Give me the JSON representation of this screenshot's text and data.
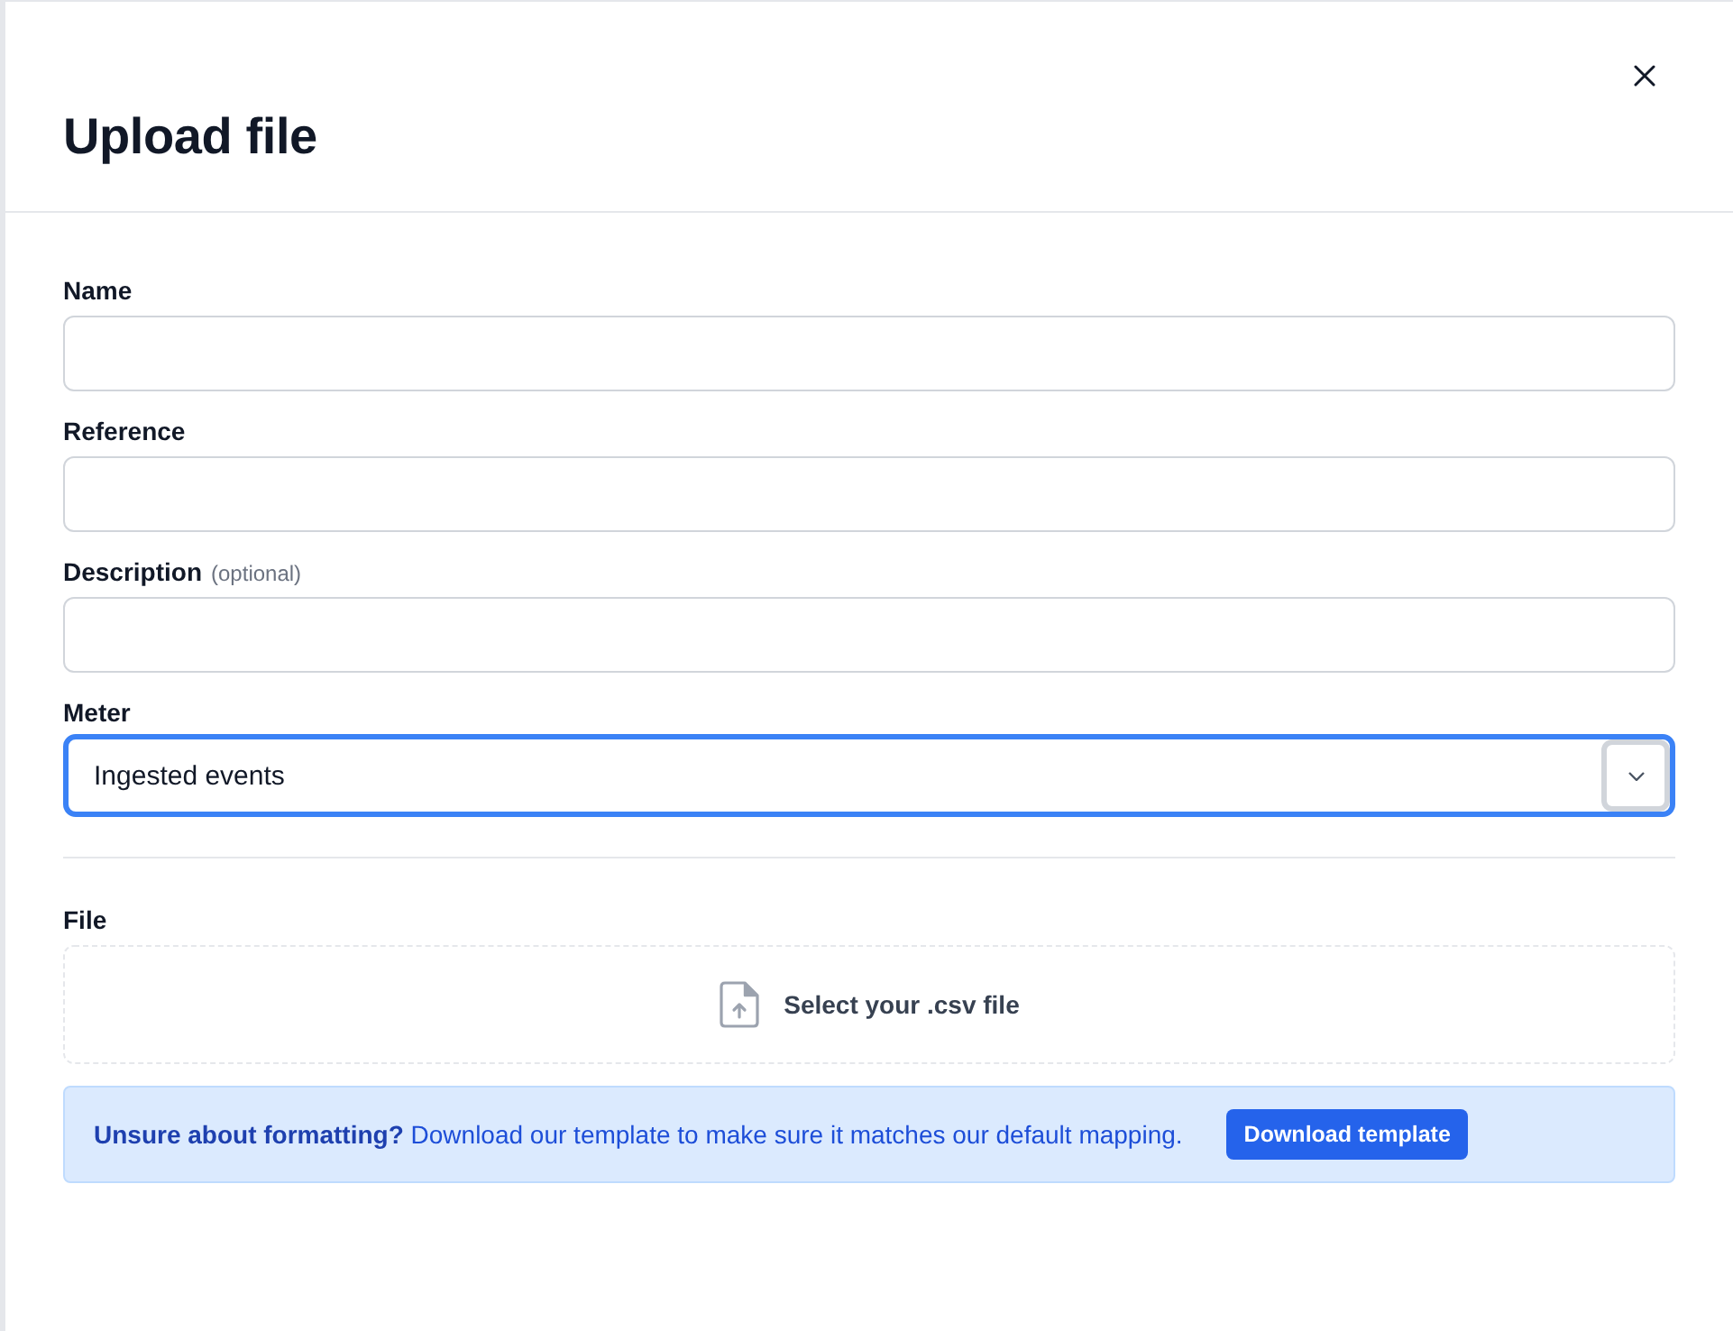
{
  "dialog": {
    "title": "Upload file"
  },
  "fields": [
    {
      "kind": "text",
      "label": "Name"
    },
    {
      "kind": "text",
      "label": "Reference"
    },
    {
      "kind": "text",
      "label": "Description",
      "hint": "(optional)"
    },
    {
      "kind": "select",
      "label": "Meter",
      "value": "Ingested events",
      "focused": true
    }
  ],
  "file": {
    "label": "File",
    "prompt": "Select your .csv file"
  },
  "notice": {
    "text": "**Unsure about formatting?** Download our template to make sure it matches our default mapping.",
    "button": "Download template"
  }
}
